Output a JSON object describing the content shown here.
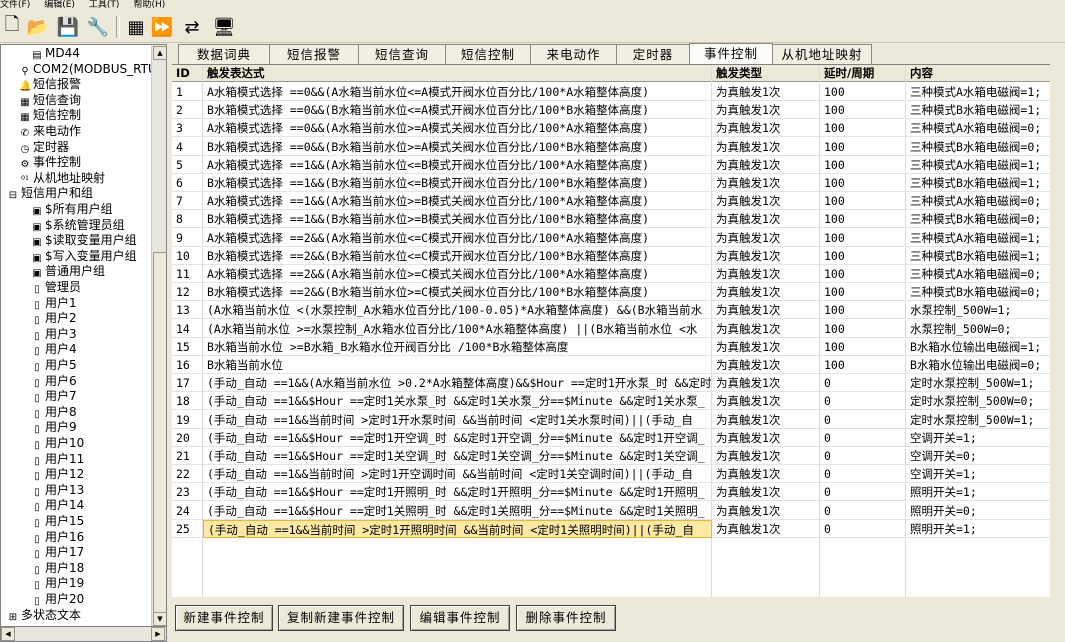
{
  "menu": [
    "文件(F)",
    "编辑(E)",
    "工具(T)",
    "帮助(H)"
  ],
  "toolbar": {
    "buttons": [
      {
        "name": "new-icon",
        "glyph": "🗋"
      },
      {
        "name": "open-folder-icon",
        "glyph": "📂"
      },
      {
        "name": "save-icon",
        "glyph": "💾"
      },
      {
        "name": "wrench-icon",
        "glyph": "🔧"
      },
      {
        "name": "grid-icon",
        "glyph": "▦"
      },
      {
        "name": "run-icon",
        "glyph": "⏩"
      },
      {
        "name": "transfer-icon",
        "glyph": "⇄"
      },
      {
        "name": "monitor-icon",
        "glyph": "🖥"
      }
    ]
  },
  "tree": [
    {
      "label": "MD44",
      "icon": "▤",
      "indent": 2
    },
    {
      "label": "COM2(MODBUS_RTU_SE",
      "icon": "⚲",
      "indent": 1
    },
    {
      "label": "短信报警",
      "icon": "🔔",
      "indent": 1
    },
    {
      "label": "短信查询",
      "icon": "▦",
      "indent": 1
    },
    {
      "label": "短信控制",
      "icon": "▦",
      "indent": 1
    },
    {
      "label": "来电动作",
      "icon": "✆",
      "indent": 1
    },
    {
      "label": "定时器",
      "icon": "◷",
      "indent": 1
    },
    {
      "label": "事件控制",
      "icon": "⚙",
      "indent": 1
    },
    {
      "label": "从机地址映射",
      "icon": "⁰¹",
      "indent": 1
    },
    {
      "label": "短信用户和组",
      "icon": "⊟",
      "indent": 0
    },
    {
      "label": "$所有用户组",
      "icon": "▣",
      "indent": 2
    },
    {
      "label": "$系统管理员组",
      "icon": "▣",
      "indent": 2
    },
    {
      "label": "$读取变量用户组",
      "icon": "▣",
      "indent": 2
    },
    {
      "label": "$写入变量用户组",
      "icon": "▣",
      "indent": 2
    },
    {
      "label": "普通用户组",
      "icon": "▣",
      "indent": 2
    },
    {
      "label": "管理员",
      "icon": "▯",
      "indent": 2
    },
    {
      "label": "用户1",
      "icon": "▯",
      "indent": 2
    },
    {
      "label": "用户2",
      "icon": "▯",
      "indent": 2
    },
    {
      "label": "用户3",
      "icon": "▯",
      "indent": 2
    },
    {
      "label": "用户4",
      "icon": "▯",
      "indent": 2
    },
    {
      "label": "用户5",
      "icon": "▯",
      "indent": 2
    },
    {
      "label": "用户6",
      "icon": "▯",
      "indent": 2
    },
    {
      "label": "用户7",
      "icon": "▯",
      "indent": 2
    },
    {
      "label": "用户8",
      "icon": "▯",
      "indent": 2
    },
    {
      "label": "用户9",
      "icon": "▯",
      "indent": 2
    },
    {
      "label": "用户10",
      "icon": "▯",
      "indent": 2
    },
    {
      "label": "用户11",
      "icon": "▯",
      "indent": 2
    },
    {
      "label": "用户12",
      "icon": "▯",
      "indent": 2
    },
    {
      "label": "用户13",
      "icon": "▯",
      "indent": 2
    },
    {
      "label": "用户14",
      "icon": "▯",
      "indent": 2
    },
    {
      "label": "用户15",
      "icon": "▯",
      "indent": 2
    },
    {
      "label": "用户16",
      "icon": "▯",
      "indent": 2
    },
    {
      "label": "用户17",
      "icon": "▯",
      "indent": 2
    },
    {
      "label": "用户18",
      "icon": "▯",
      "indent": 2
    },
    {
      "label": "用户19",
      "icon": "▯",
      "indent": 2
    },
    {
      "label": "用户20",
      "icon": "▯",
      "indent": 2
    },
    {
      "label": "多状态文本",
      "icon": "⊞",
      "indent": 0
    }
  ],
  "tabs": [
    {
      "label": "数据词典",
      "active": false
    },
    {
      "label": "短信报警",
      "active": false
    },
    {
      "label": "短信查询",
      "active": false
    },
    {
      "label": "短信控制",
      "active": false
    },
    {
      "label": "来电动作",
      "active": false
    },
    {
      "label": "定时器",
      "active": false
    },
    {
      "label": "事件控制",
      "active": true
    },
    {
      "label": "从机地址映射",
      "active": false
    }
  ],
  "table": {
    "headers": [
      "ID",
      "触发表达式",
      "触发类型",
      "延时/周期",
      "内容"
    ],
    "selected_id": "25",
    "rows": [
      [
        "1",
        "A水箱模式选择 ==0&&(A水箱当前水位<=A模式开阀水位百分比/100*A水箱整体高度)",
        "为真触发1次",
        "100",
        "三种模式A水箱电磁阀=1;"
      ],
      [
        "2",
        "B水箱模式选择 ==0&&(B水箱当前水位<=A模式开阀水位百分比/100*B水箱整体高度)",
        "为真触发1次",
        "100",
        "三种模式B水箱电磁阀=1;"
      ],
      [
        "3",
        "A水箱模式选择 ==0&&(A水箱当前水位>=A模式关阀水位百分比/100*A水箱整体高度)",
        "为真触发1次",
        "100",
        "三种模式A水箱电磁阀=0;"
      ],
      [
        "4",
        "B水箱模式选择 ==0&&(B水箱当前水位>=A模式关阀水位百分比/100*B水箱整体高度)",
        "为真触发1次",
        "100",
        "三种模式B水箱电磁阀=0;"
      ],
      [
        "5",
        "A水箱模式选择 ==1&&(A水箱当前水位<=B模式开阀水位百分比/100*A水箱整体高度)",
        "为真触发1次",
        "100",
        "三种模式A水箱电磁阀=1;"
      ],
      [
        "6",
        "B水箱模式选择 ==1&&(B水箱当前水位<=B模式开阀水位百分比/100*B水箱整体高度)",
        "为真触发1次",
        "100",
        "三种模式B水箱电磁阀=1;"
      ],
      [
        "7",
        "A水箱模式选择 ==1&&(A水箱当前水位>=B模式关阀水位百分比/100*A水箱整体高度)",
        "为真触发1次",
        "100",
        "三种模式A水箱电磁阀=0;"
      ],
      [
        "8",
        "B水箱模式选择 ==1&&(B水箱当前水位>=B模式关阀水位百分比/100*B水箱整体高度)",
        "为真触发1次",
        "100",
        "三种模式B水箱电磁阀=0;"
      ],
      [
        "9",
        "A水箱模式选择 ==2&&(A水箱当前水位<=C模式开阀水位百分比/100*A水箱整体高度)",
        "为真触发1次",
        "100",
        "三种模式A水箱电磁阀=1;"
      ],
      [
        "10",
        "B水箱模式选择 ==2&&(B水箱当前水位<=C模式开阀水位百分比/100*B水箱整体高度)",
        "为真触发1次",
        "100",
        "三种模式B水箱电磁阀=1;"
      ],
      [
        "11",
        "A水箱模式选择 ==2&&(A水箱当前水位>=C模式关阀水位百分比/100*A水箱整体高度)",
        "为真触发1次",
        "100",
        "三种模式A水箱电磁阀=0;"
      ],
      [
        "12",
        "B水箱模式选择 ==2&&(B水箱当前水位>=C模式关阀水位百分比/100*B水箱整体高度)",
        "为真触发1次",
        "100",
        "三种模式B水箱电磁阀=0;"
      ],
      [
        "13",
        "(A水箱当前水位 <(水泵控制_A水箱水位百分比/100-0.05)*A水箱整体高度) &&(B水箱当前水",
        "为真触发1次",
        "100",
        "水泵控制_500W=1;"
      ],
      [
        "14",
        "(A水箱当前水位 >=水泵控制_A水箱水位百分比/100*A水箱整体高度) ||(B水箱当前水位 <水",
        "为真触发1次",
        "100",
        "水泵控制_500W=0;"
      ],
      [
        "15",
        "B水箱当前水位 >=B水箱_B水箱水位开阀百分比  /100*B水箱整体高度",
        "为真触发1次",
        "100",
        "B水箱水位输出电磁阀=1;"
      ],
      [
        "16",
        "B水箱当前水位",
        "为真触发1次",
        "100",
        "B水箱水位输出电磁阀=0;"
      ],
      [
        "17",
        "(手动_自动 ==1&&(A水箱当前水位 >0.2*A水箱整体高度)&&$Hour ==定时1开水泵_时 &&定时",
        "为真触发1次",
        "0",
        "定时水泵控制_500W=1;"
      ],
      [
        "18",
        "(手动_自动 ==1&&$Hour ==定时1关水泵_时 &&定时1关水泵_分==$Minute  &&定时1关水泵_",
        "为真触发1次",
        "0",
        "定时水泵控制_500W=0;"
      ],
      [
        "19",
        "(手动_自动 ==1&&当前时间 >定时1开水泵时间 &&当前时间 <定时1关水泵时间)||(手动_自",
        "为真触发1次",
        "0",
        "定时水泵控制_500W=1;"
      ],
      [
        "20",
        "(手动_自动 ==1&&$Hour ==定时1开空调_时 &&定时1开空调_分==$Minute  &&定时1开空调_",
        "为真触发1次",
        "0",
        "空调开关=1;"
      ],
      [
        "21",
        "(手动_自动 ==1&&$Hour ==定时1关空调_时 &&定时1关空调_分==$Minute  &&定时1关空调_",
        "为真触发1次",
        "0",
        "空调开关=0;"
      ],
      [
        "22",
        "(手动_自动 ==1&&当前时间 >定时1开空调时间 &&当前时间 <定时1关空调时间)||(手动_自",
        "为真触发1次",
        "0",
        "空调开关=1;"
      ],
      [
        "23",
        "(手动_自动 ==1&&$Hour ==定时1开照明_时 &&定时1开照明_分==$Minute  &&定时1开照明_",
        "为真触发1次",
        "0",
        "照明开关=1;"
      ],
      [
        "24",
        "(手动_自动 ==1&&$Hour ==定时1关照明_时 &&定时1关照明_分==$Minute  &&定时1关照明_",
        "为真触发1次",
        "0",
        "照明开关=0;"
      ],
      [
        "25",
        "(手动_自动 ==1&&当前时间 >定时1开照明时间 &&当前时间 <定时1关照明时间)||(手动_自",
        "为真触发1次",
        "0",
        "照明开关=1;"
      ]
    ]
  },
  "buttons": {
    "new": "新建事件控制",
    "copy_new": "复制新建事件控制",
    "edit": "编辑事件控制",
    "delete": "删除事件控制"
  }
}
